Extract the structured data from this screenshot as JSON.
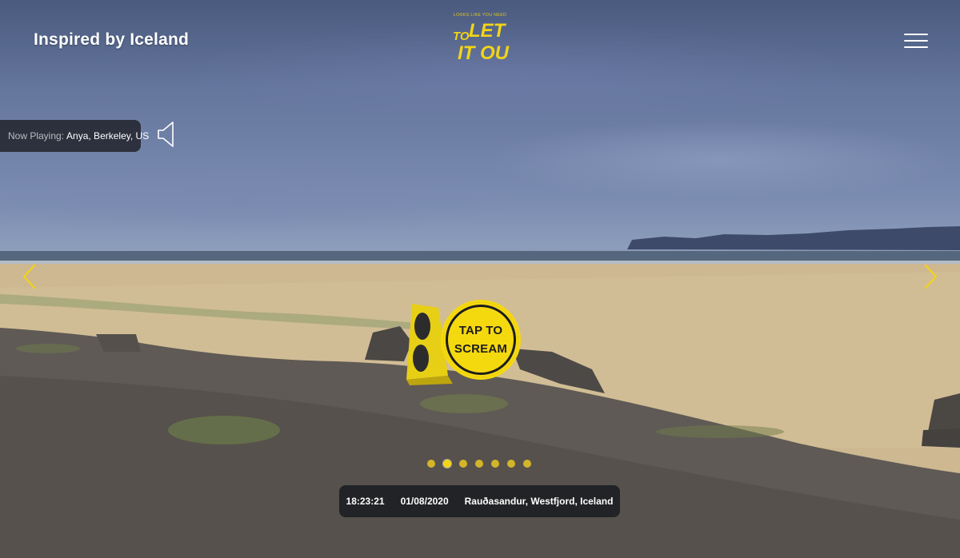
{
  "header": {
    "brand_title": "Inspired by Iceland",
    "logo_text": "TO LET IT OUT",
    "menu_icon": "hamburger-icon"
  },
  "now_playing": {
    "label": "Now Playing:",
    "name": "Anya",
    "location": ", Berkeley, US",
    "sound_icon": "speaker-icon"
  },
  "navigation": {
    "prev_icon": "chevron-left-icon",
    "next_icon": "chevron-right-icon"
  },
  "scream_button": {
    "line1": "TAP TO",
    "line2": "SCREAM"
  },
  "pagination": {
    "count": 7,
    "active_index": 1
  },
  "info": {
    "time": "18:23:21",
    "date": "01/08/2020",
    "place": "Rauðasandur, Westfjord, Iceland"
  },
  "colors": {
    "accent_yellow": "#f5d90f",
    "panel_dark": "#1c1e22"
  }
}
